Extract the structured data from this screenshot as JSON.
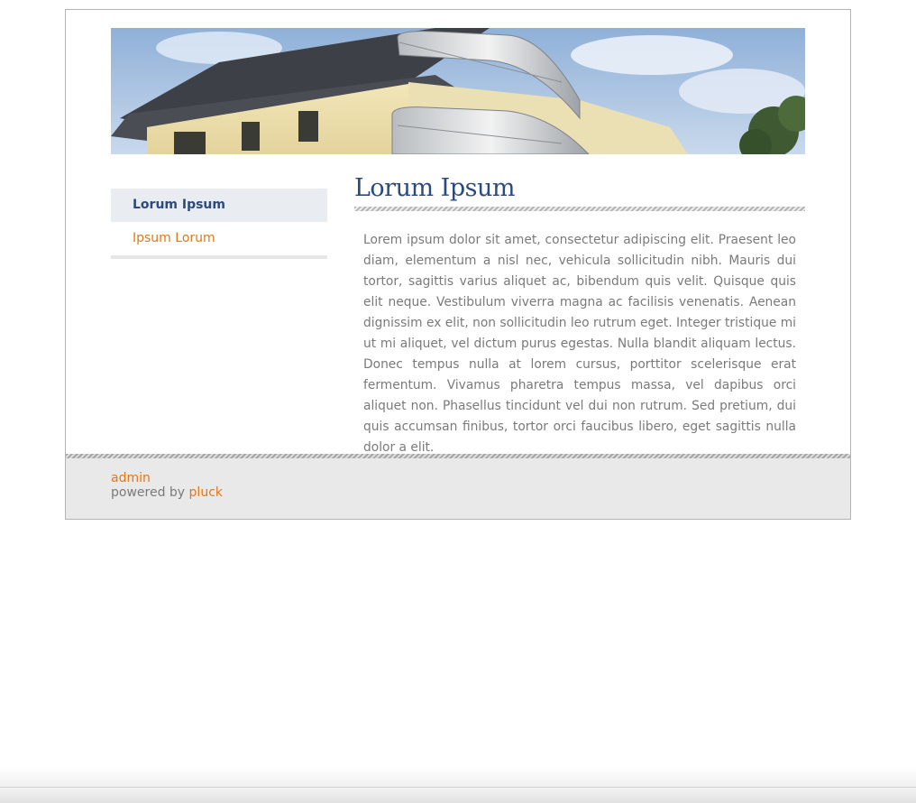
{
  "header": {
    "banner_alt": "Building with balconies"
  },
  "sidebar": {
    "items": [
      {
        "label": "Lorum Ipsum",
        "active": true
      },
      {
        "label": "Ipsum Lorum",
        "active": false
      }
    ]
  },
  "main": {
    "title": "Lorum Ipsum",
    "body": "Lorem ipsum dolor sit amet, consectetur adipiscing elit. Praesent leo diam, elementum a nisl nec, vehicula sollicitudin nibh. Mauris dui tortor, sagittis varius aliquet ac, bibendum quis velit. Quisque quis elit neque. Vestibulum viverra magna ac facilisis venenatis. Aenean dignissim ex elit, non sollicitudin leo rutrum eget. Integer tristique mi ut mi aliquet, vel dictum purus egestas. Nulla blandit aliquam lectus. Donec tempus nulla at lorem cursus, porttitor scelerisque erat fermentum. Vivamus pharetra tempus massa, vel dapibus orci aliquet non. Phasellus tincidunt vel dui non rutrum. Sed pretium, dui quis accumsan finibus, tortor orci faucibus libero, eget sagittis nulla dolor a elit."
  },
  "footer": {
    "admin_label": "admin",
    "powered_by": "powered by",
    "pluck_label": "pluck"
  },
  "colors": {
    "accent_blue": "#2c4b7c",
    "link_orange": "#e0781a",
    "text_gray": "#7a7a7a"
  }
}
